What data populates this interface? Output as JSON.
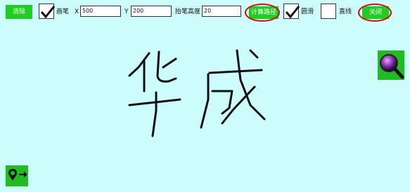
{
  "toolbar": {
    "clear_label": "清除",
    "pen_label": "画笔",
    "x_label": "X",
    "x_value": "500",
    "y_label": "Y",
    "y_value": "200",
    "lift_label": "抬笔高度",
    "lift_value": "20",
    "compute_label": "计算路径",
    "circle_label": "圆滑",
    "line_label": "直线",
    "close_label": "关闭",
    "pen_checked": true,
    "circle_checked": true,
    "line_checked": false
  },
  "canvas": {
    "text": "华成"
  },
  "icons": {
    "zoom": "magnifier-icon",
    "location": "location-pin-icon"
  },
  "colors": {
    "background": "#ccfcfc",
    "button_green": "#22cc22",
    "highlight_ring": "#cc1111"
  }
}
